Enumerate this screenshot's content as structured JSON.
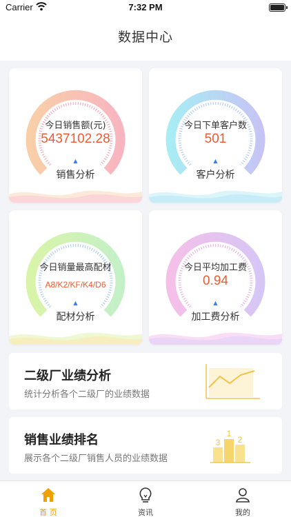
{
  "status_bar": {
    "carrier": "Carrier",
    "time": "7:32 PM"
  },
  "header": {
    "title": "数据中心"
  },
  "cards": [
    {
      "label": "今日销售额(元)",
      "value": "5437102.28",
      "link": "销售分析"
    },
    {
      "label": "今日下单客户数",
      "value": "501",
      "link": "客户分析"
    },
    {
      "label": "今日销量最高配材",
      "value": "A8/K2/KF/K4/D6",
      "link": "配材分析"
    },
    {
      "label": "今日平均加工费",
      "value": "0.94",
      "link": "加工费分析"
    }
  ],
  "sections": [
    {
      "title": "二级厂业绩分析",
      "subtitle": "统计分析各个二级厂的业绩数据"
    },
    {
      "title": "销售业绩排名",
      "subtitle": "展示各个二级厂销售人员的业绩数据"
    }
  ],
  "ranking_icon": {
    "labels": [
      "1",
      "2",
      "3"
    ]
  },
  "tabs": [
    {
      "label": "首 页",
      "icon": "home-icon",
      "active": true
    },
    {
      "label": "资讯",
      "icon": "lightbulb-icon",
      "active": false
    },
    {
      "label": "我的",
      "icon": "person-icon",
      "active": false
    }
  ],
  "colors": {
    "accent": "#f0a000",
    "value_text": "#ee5a2f",
    "pointer": "#3b7de8",
    "gauge_sales": [
      "#f8cfa8",
      "#f8b5c0"
    ],
    "gauge_customers": [
      "#a8ecf4",
      "#c6c4f4"
    ],
    "gauge_material": [
      "#d8f4a8",
      "#c4f0c8"
    ],
    "gauge_fee": [
      "#f4c0e8",
      "#d6c6f6"
    ]
  }
}
